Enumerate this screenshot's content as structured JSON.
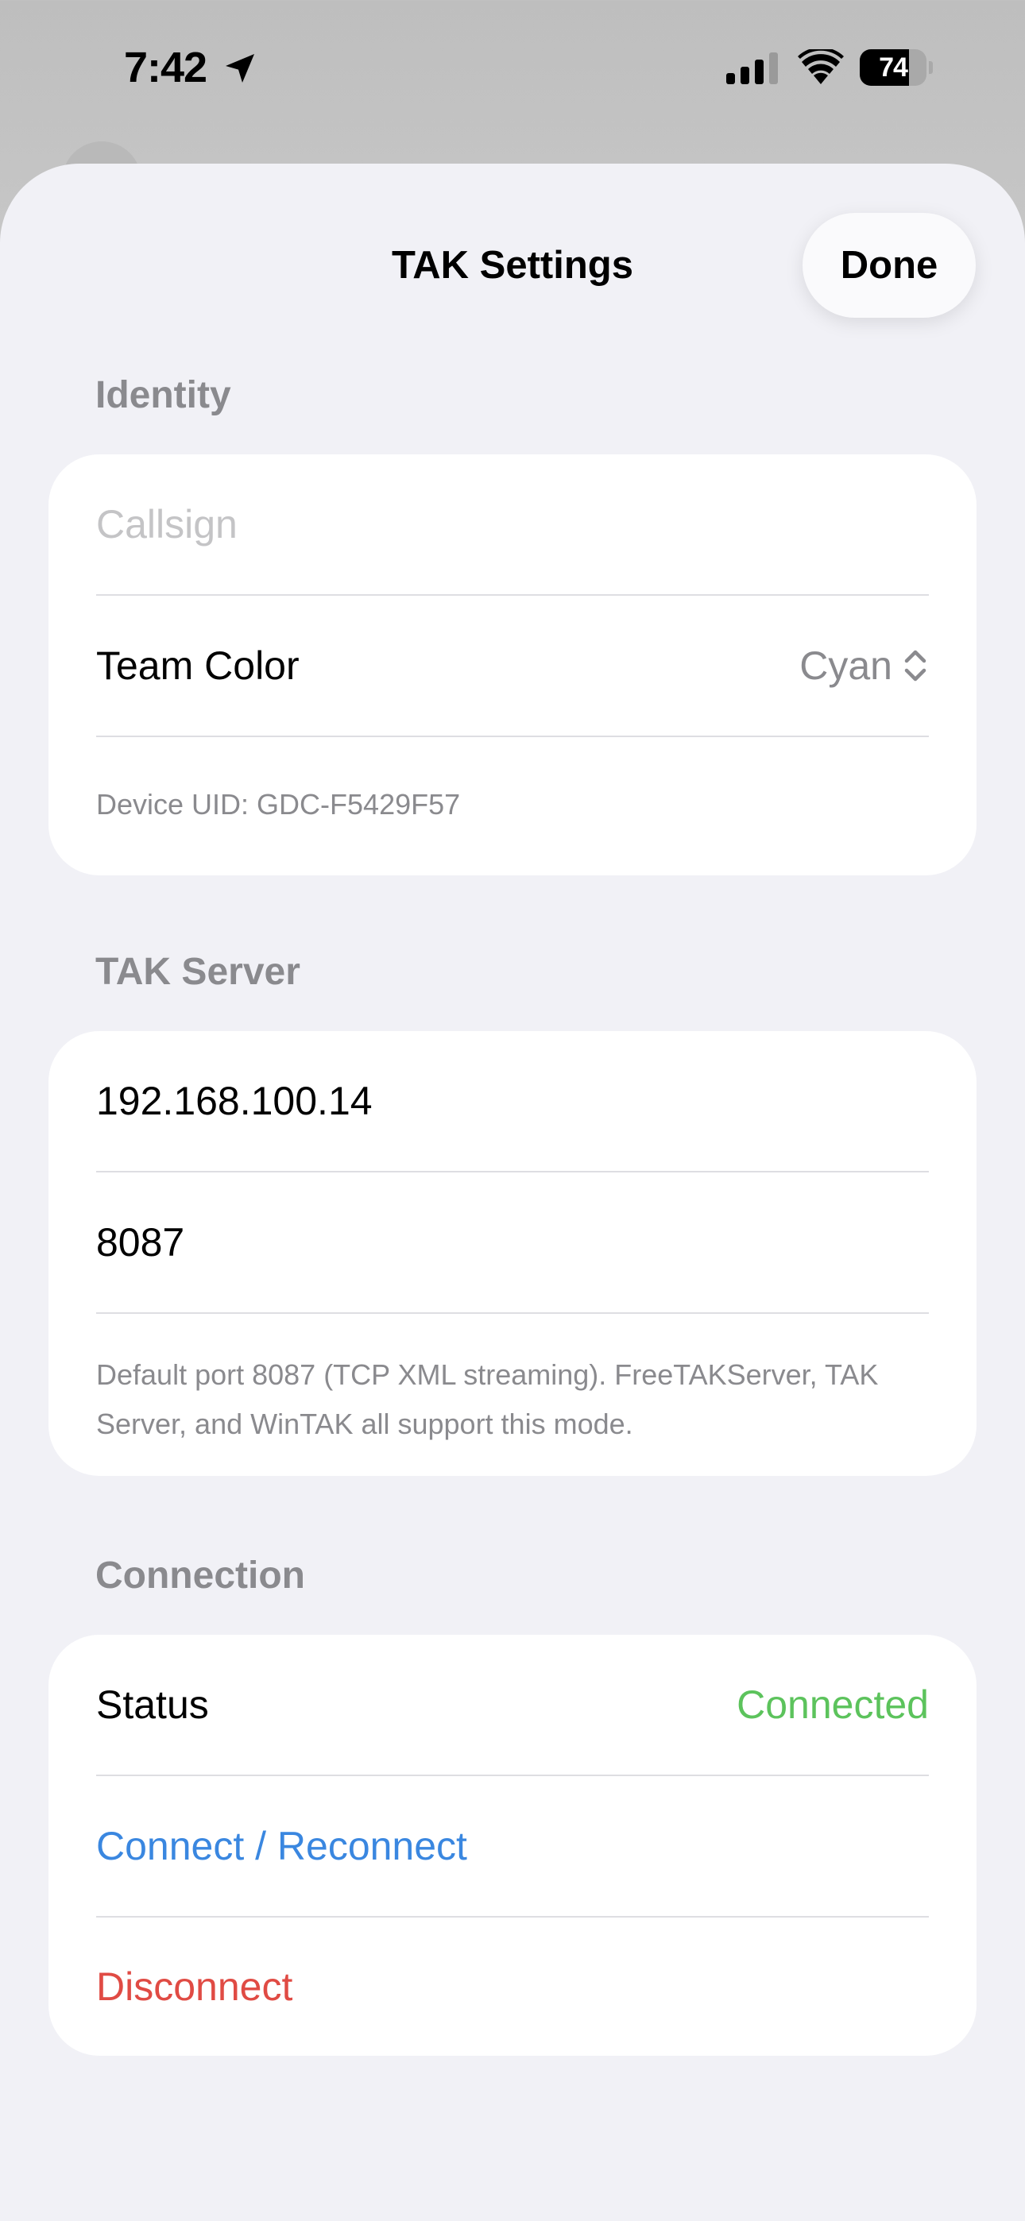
{
  "status_bar": {
    "time": "7:42",
    "battery_level": "74",
    "battery_fraction": 0.74
  },
  "sheet": {
    "title": "TAK Settings",
    "done_label": "Done"
  },
  "identity": {
    "header": "Identity",
    "callsign_placeholder": "Callsign",
    "callsign_value": "",
    "team_color_label": "Team Color",
    "team_color_value": "Cyan",
    "device_uid": "Device UID: GDC-F5429F57"
  },
  "server": {
    "header": "TAK Server",
    "host": "192.168.100.14",
    "port": "8087",
    "footnote": "Default port 8087 (TCP XML streaming). FreeTAKServer, TAK Server, and WinTAK all support this mode."
  },
  "connection": {
    "header": "Connection",
    "status_label": "Status",
    "status_value": "Connected",
    "connect_label": "Connect / Reconnect",
    "disconnect_label": "Disconnect"
  },
  "colors": {
    "accent_blue": "#3a87e0",
    "status_green": "#5cc35c",
    "destructive_red": "#e04b44",
    "sheet_background": "#f1f1f6"
  },
  "icons": [
    "location-arrow-icon",
    "cellular-signal-icon",
    "wifi-icon",
    "battery-icon",
    "chevron-up-down-icon"
  ]
}
